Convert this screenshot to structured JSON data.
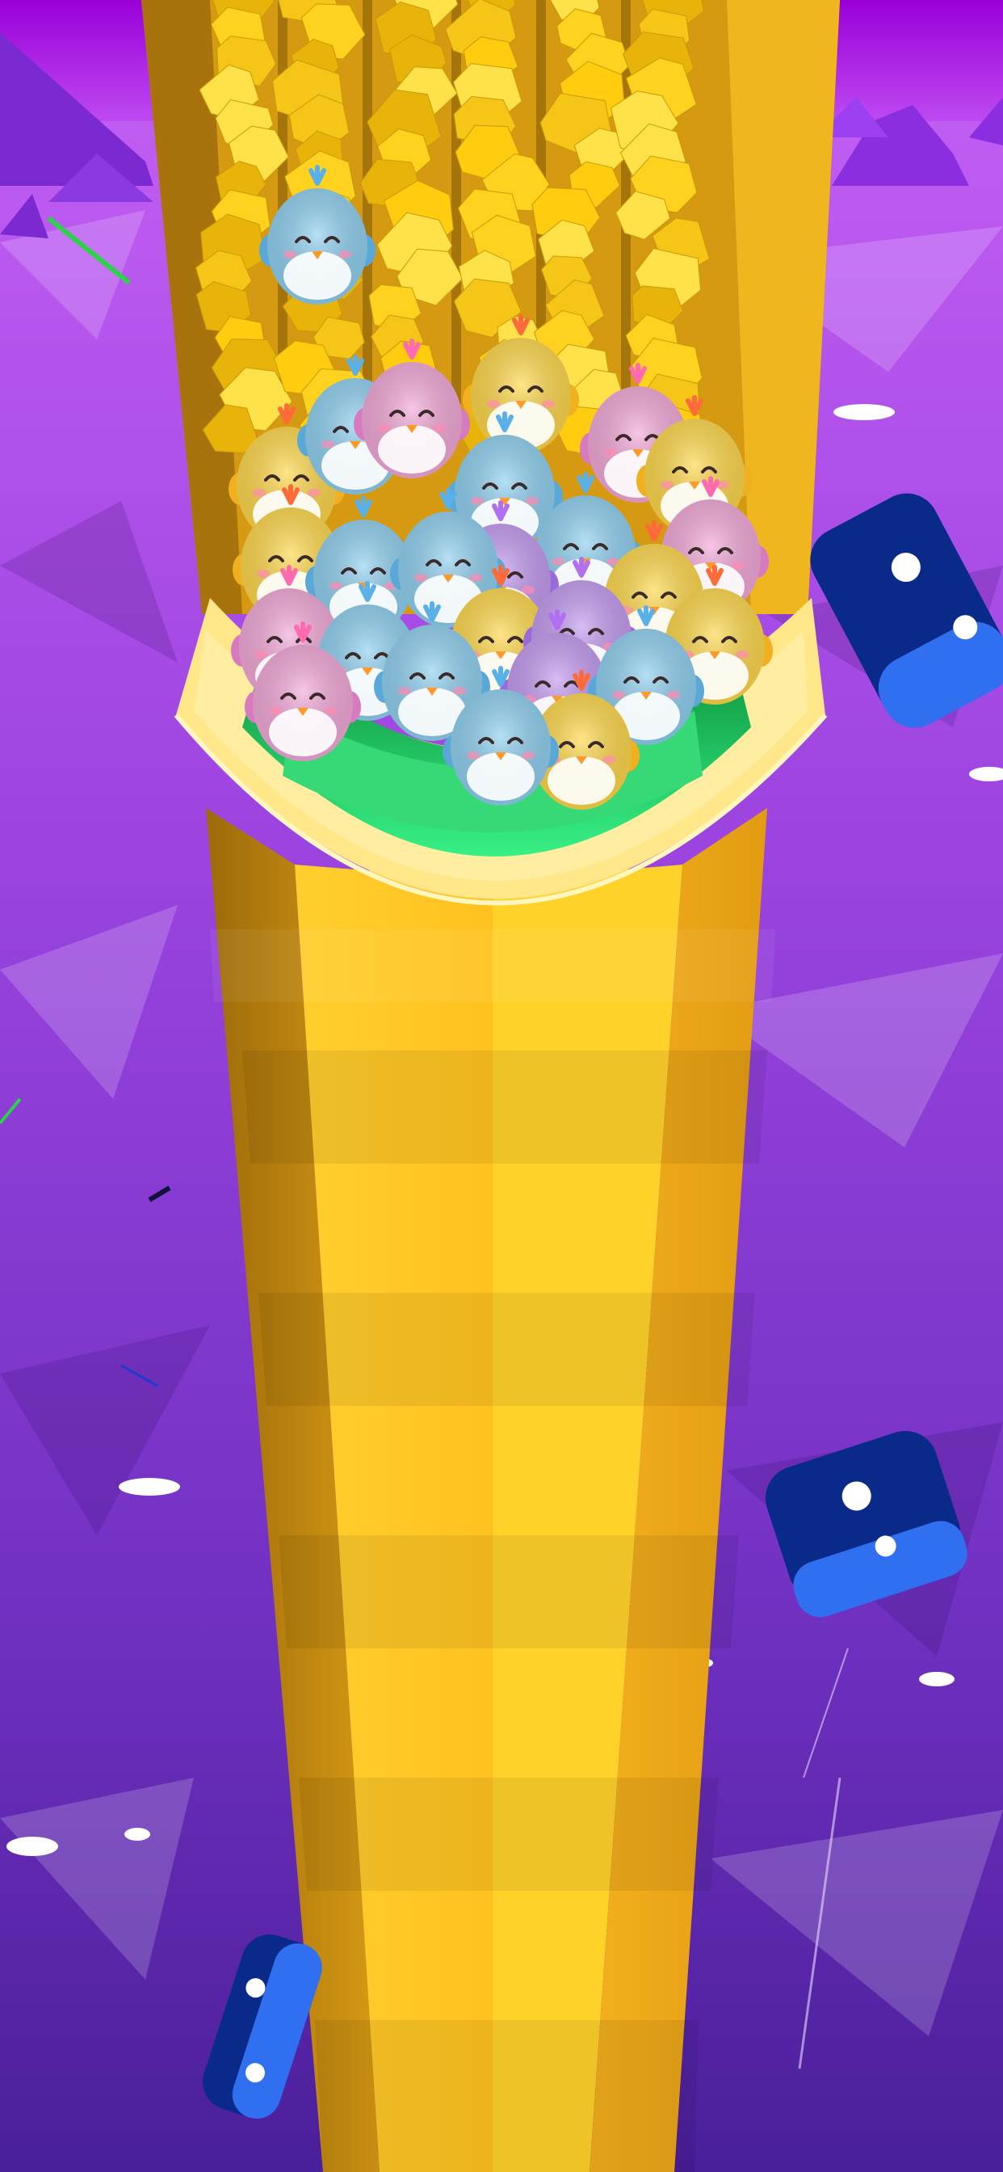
{
  "scene": {
    "title": "",
    "colors": {
      "sky_top": "#b400e6",
      "sea_top": "#b04ce8",
      "sea_mid": "#8a3fd6",
      "sea_bottom": "#4a1f9a",
      "tower_light": "#ffc425",
      "tower_mid": "#f2a91c",
      "tower_dark": "#b07d10",
      "bowl_rim": "#ffe67a",
      "bowl_inner": "#2fe07a",
      "block_dark": "#0a2a8a",
      "block_light": "#2f6ff0",
      "ore": "#ffd21f"
    },
    "birds": [
      {
        "color": "blue"
      },
      {
        "color": "yellow"
      },
      {
        "color": "blue"
      },
      {
        "color": "pink"
      },
      {
        "color": "yellow"
      },
      {
        "color": "blue"
      },
      {
        "color": "pink"
      },
      {
        "color": "yellow"
      },
      {
        "color": "blue"
      },
      {
        "color": "yellow"
      },
      {
        "color": "blue"
      },
      {
        "color": "purple"
      },
      {
        "color": "pink"
      },
      {
        "color": "yellow"
      },
      {
        "color": "blue"
      },
      {
        "color": "pink"
      },
      {
        "color": "blue"
      },
      {
        "color": "yellow"
      },
      {
        "color": "purple"
      },
      {
        "color": "yellow"
      },
      {
        "color": "pink"
      },
      {
        "color": "blue"
      },
      {
        "color": "purple"
      },
      {
        "color": "blue"
      },
      {
        "color": "yellow"
      },
      {
        "color": "blue"
      }
    ],
    "obstacles": [
      {
        "name": "floating-block-right-top"
      },
      {
        "name": "floating-block-right-mid"
      },
      {
        "name": "floating-block-left-bottom"
      }
    ]
  }
}
